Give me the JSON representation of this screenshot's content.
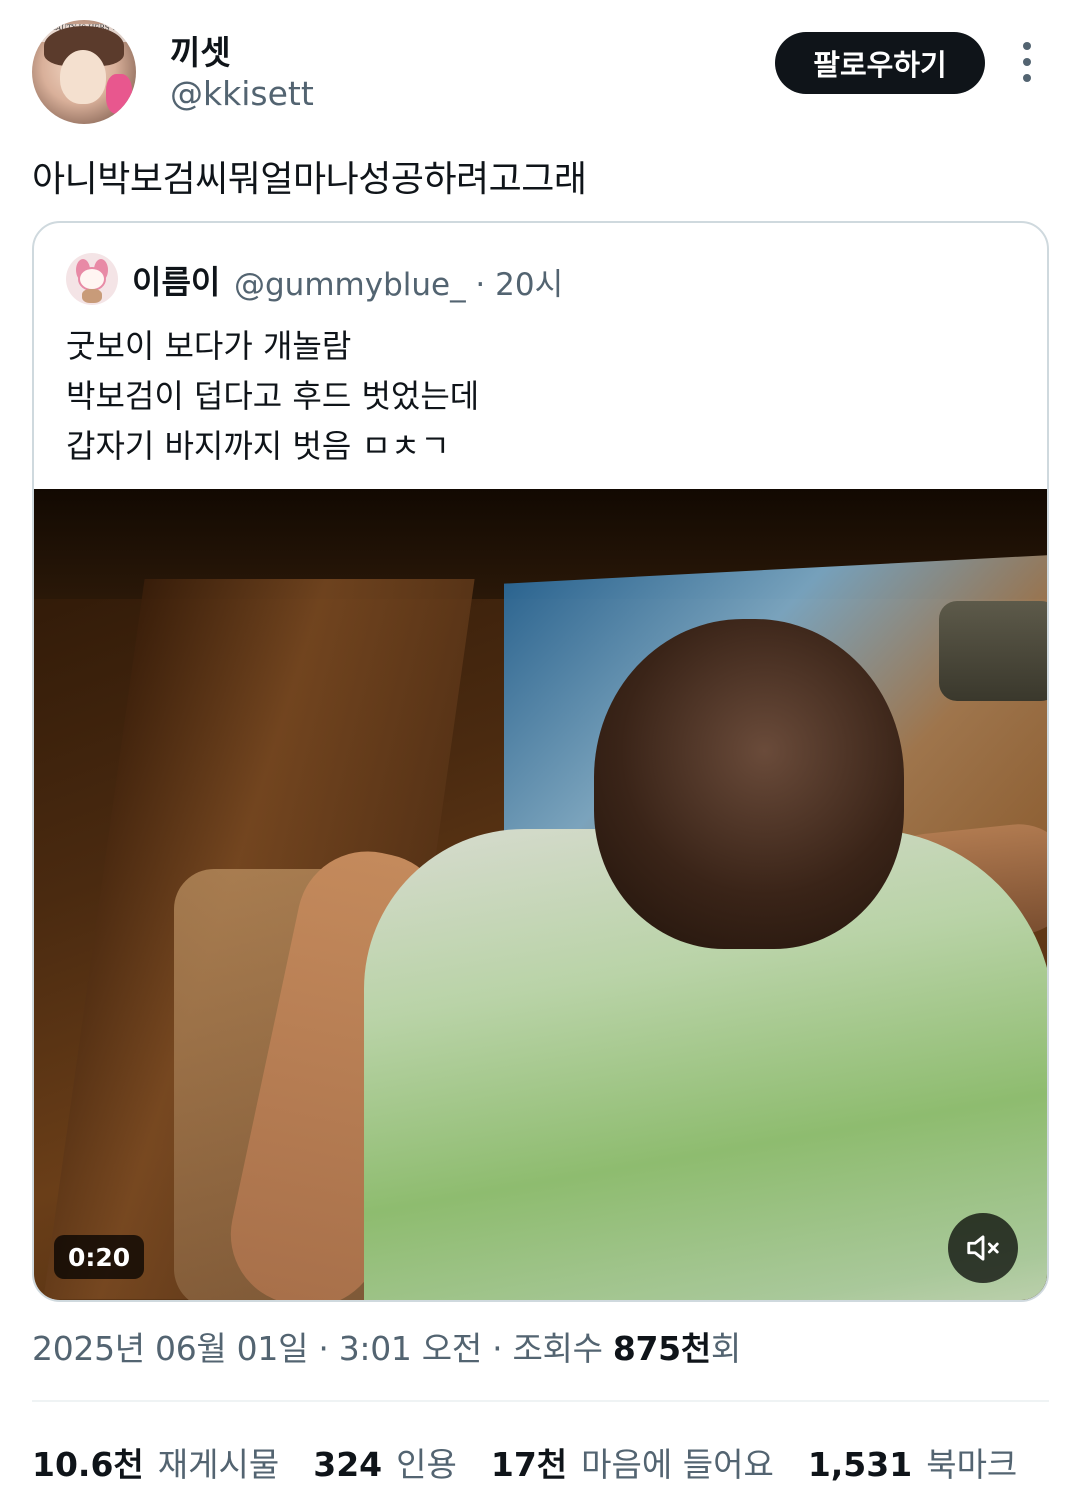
{
  "author": {
    "display_name": "끼셋",
    "handle": "@kkisett",
    "avatar_banner_text": "BEAUTY IS HERS TO DEFINE"
  },
  "follow_button": {
    "label": "팔로우하기"
  },
  "more_icon": "more-vertical-icon",
  "tweet": {
    "text": "아니박보검씨뭐얼마나성공하려고그래"
  },
  "quoted": {
    "display_name": "이름이",
    "handle_time": "@gummyblue_ · 20시",
    "lines": [
      "굿보이 보다가 개놀람",
      "박보검이 덥다고 후드 벗었는데",
      "갑자기 바지까지 벗음 ㅁㅊㄱ"
    ],
    "video": {
      "duration": "0:20",
      "mute_icon": "volume-muted-icon"
    }
  },
  "meta": {
    "date_time": "2025년 06월 01일 · 3:01 오전 · 조회수 ",
    "views": "875천",
    "views_suffix": "회"
  },
  "stats": [
    {
      "value": "10.6천",
      "label": "재게시물"
    },
    {
      "value": "324",
      "label": "인용"
    },
    {
      "value": "17천",
      "label": "마음에 들어요"
    },
    {
      "value": "1,531",
      "label": "북마크"
    }
  ],
  "colors": {
    "text_primary": "#0f1419",
    "text_secondary": "#536471",
    "border": "#cfd9de",
    "button_bg": "#0f1419"
  }
}
